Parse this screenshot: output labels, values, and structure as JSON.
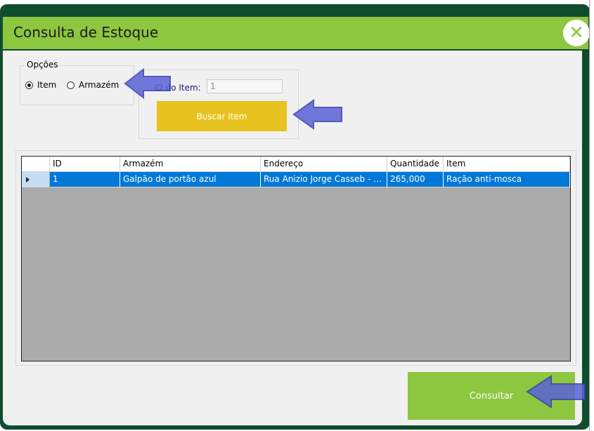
{
  "window": {
    "title": "Consulta de Estoque",
    "close_label": "✕"
  },
  "options": {
    "legend": "Opções",
    "radio_item": {
      "label": "Item",
      "checked": true
    },
    "radio_armazem": {
      "label": "Armazém",
      "checked": false
    }
  },
  "search": {
    "id_label": "ID do Item:",
    "id_value": "1",
    "button_label": "Buscar Item"
  },
  "grid": {
    "columns": [
      "ID",
      "Armazém",
      "Endereço",
      "Quantidade",
      "Item"
    ],
    "rows": [
      {
        "id": "1",
        "armazem": "Galpão de portão azul",
        "endereco": "Rua Anizio Jorge Casseb - 4...",
        "quantidade": "265,000",
        "item": "Ração anti-mosca"
      }
    ]
  },
  "footer": {
    "consultar_label": "Consultar"
  },
  "colors": {
    "accent_green": "#8dc63f",
    "frame_dark_green": "#0f4d2f",
    "buscar_yellow": "#e6c31e",
    "selection_blue": "#0078d7",
    "arrow_blue": "#5b63d6"
  }
}
